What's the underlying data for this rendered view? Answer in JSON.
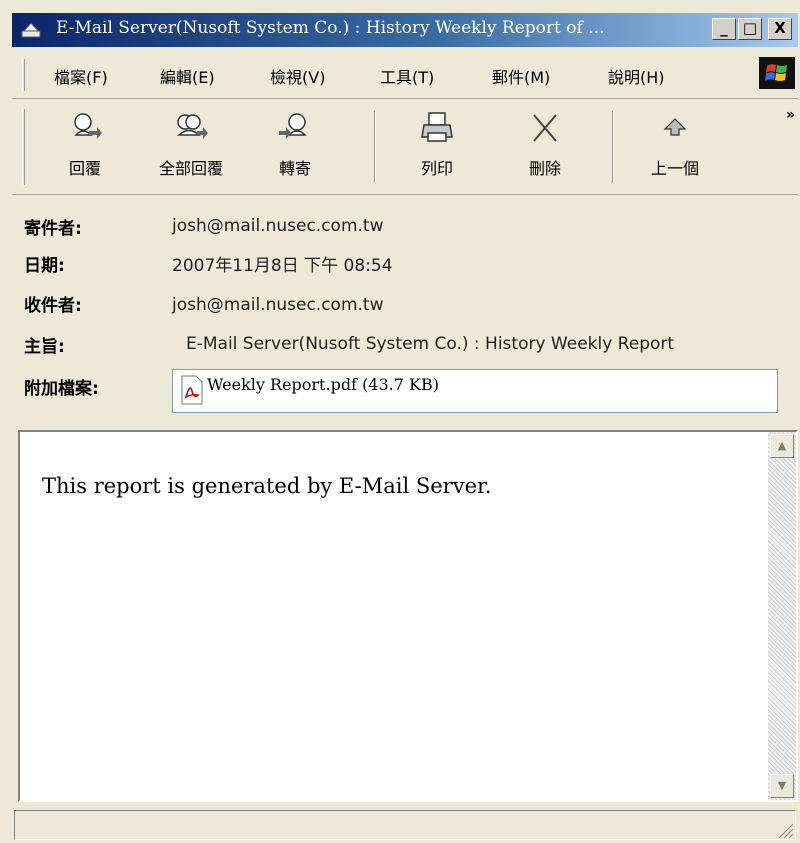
{
  "window": {
    "title": "E-Mail Server(Nusoft System Co.) : History Weekly Report of ...",
    "min_glyph": "_",
    "max_glyph": "□",
    "close_glyph": "X"
  },
  "menu": [
    {
      "label": "檔案(F)"
    },
    {
      "label": "編輯(E)"
    },
    {
      "label": "檢視(V)"
    },
    {
      "label": "工具(T)"
    },
    {
      "label": "郵件(M)"
    },
    {
      "label": "說明(H)"
    }
  ],
  "toolbar": [
    {
      "label": "回覆",
      "icon": "reply-icon"
    },
    {
      "label": "全部回覆",
      "icon": "reply-all-icon"
    },
    {
      "label": "轉寄",
      "icon": "forward-icon"
    },
    {
      "label": "列印",
      "icon": "print-icon"
    },
    {
      "label": "刪除",
      "icon": "delete-icon"
    },
    {
      "label": "上一個",
      "icon": "previous-icon"
    }
  ],
  "toolbar_more": "»",
  "header": {
    "from_label": "寄件者:",
    "from_value": "josh@mail.nusec.com.tw",
    "date_label": "日期:",
    "date_value": "2007年11月8日 下午 08:54",
    "to_label": "收件者:",
    "to_value": "josh@mail.nusec.com.tw",
    "subject_label": "主旨:",
    "subject_value": "E-Mail Server(Nusoft System Co.) : History Weekly Report",
    "attach_label": "附加檔案:",
    "attach_value": "Weekly Report.pdf (43.7 KB)"
  },
  "body": {
    "text": "This report is generated by E-Mail Server."
  },
  "colors": {
    "titlebar_start": "#0a246a",
    "titlebar_end": "#a6caf0",
    "chrome": "#ece9d8"
  }
}
